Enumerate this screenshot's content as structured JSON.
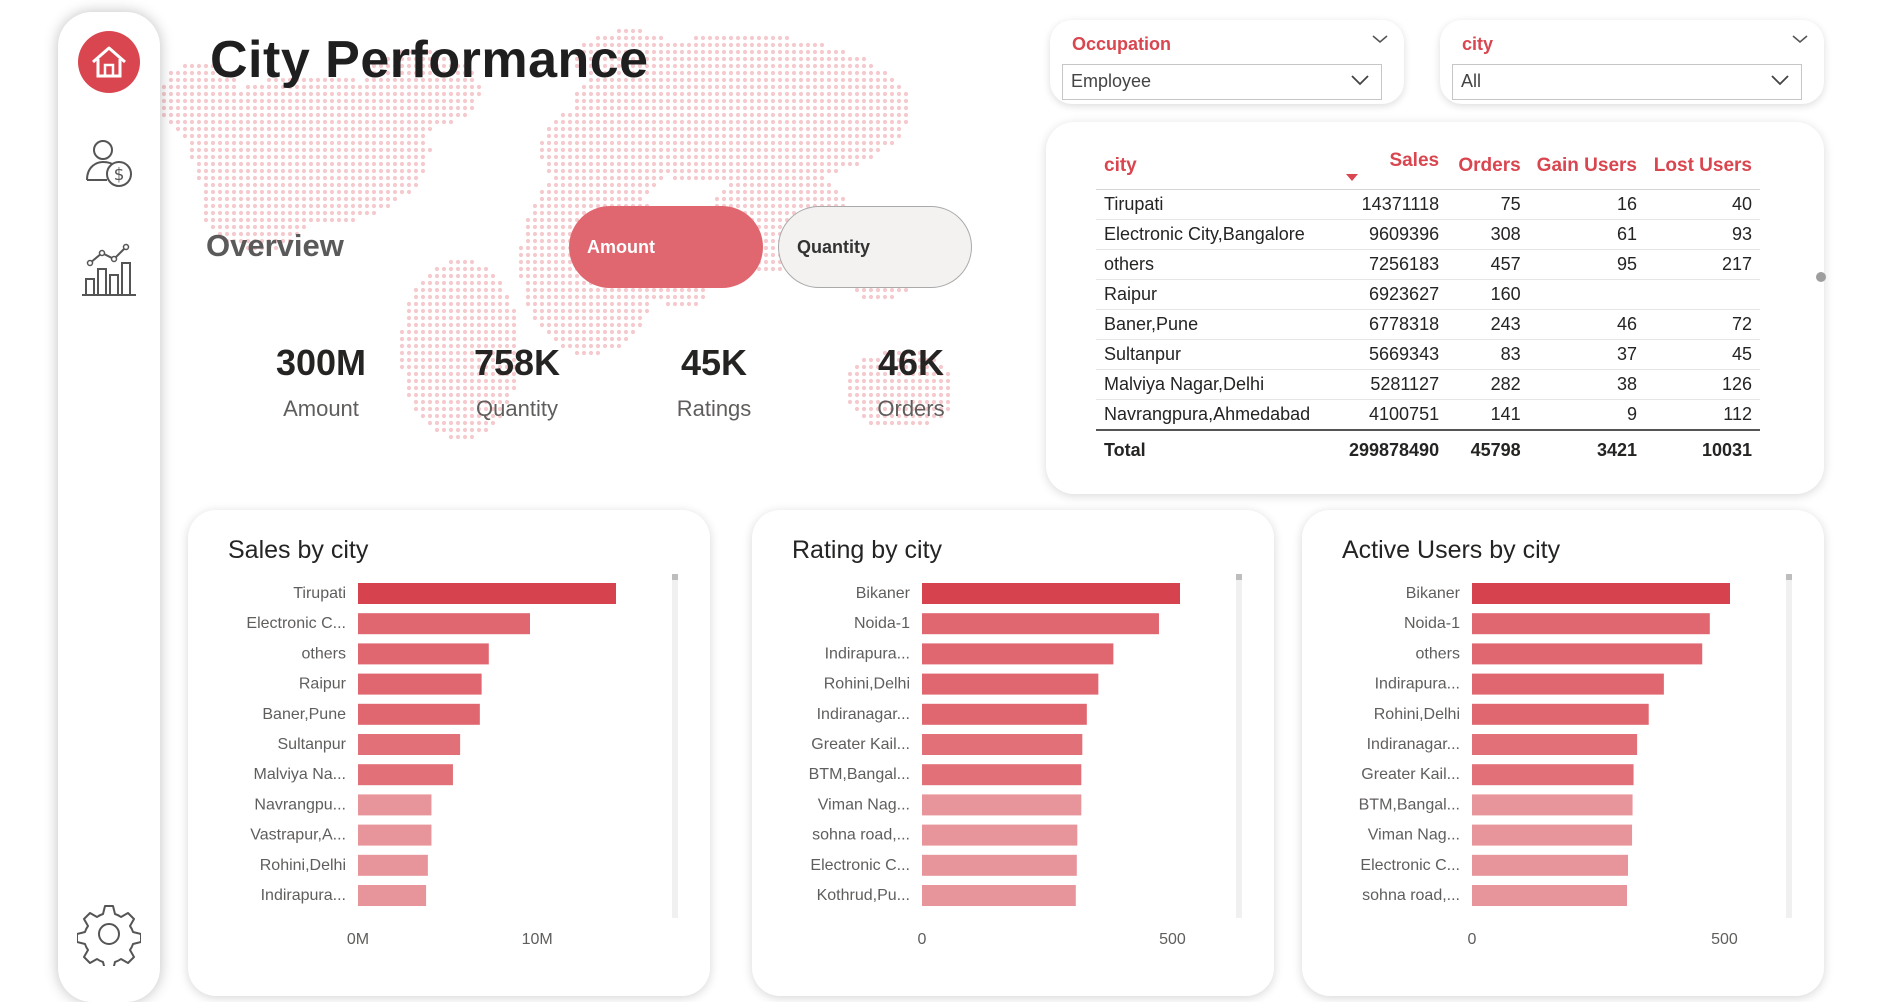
{
  "header": {
    "title": "City Performance",
    "overview_label": "Overview"
  },
  "toggles": {
    "amount": "Amount",
    "quantity": "Quantity"
  },
  "kpis": [
    {
      "value": "300M",
      "label": "Amount"
    },
    {
      "value": "758K",
      "label": "Quantity"
    },
    {
      "value": "45K",
      "label": "Ratings"
    },
    {
      "value": "46K",
      "label": "Orders"
    }
  ],
  "slicers": {
    "occupation": {
      "title": "Occupation",
      "value": "Employee"
    },
    "city": {
      "title": "city",
      "value": "All"
    }
  },
  "table": {
    "headers": [
      "city",
      "Sales",
      "Orders",
      "Gain Users",
      "Lost Users"
    ],
    "rows": [
      [
        "Tirupati",
        "14371118",
        "75",
        "16",
        "40"
      ],
      [
        "Electronic City,Bangalore",
        "9609396",
        "308",
        "61",
        "93"
      ],
      [
        "others",
        "7256183",
        "457",
        "95",
        "217"
      ],
      [
        "Raipur",
        "6923627",
        "160",
        "",
        ""
      ],
      [
        "Baner,Pune",
        "6778318",
        "243",
        "46",
        "72"
      ],
      [
        "Sultanpur",
        "5669343",
        "83",
        "37",
        "45"
      ],
      [
        "Malviya Nagar,Delhi",
        "5281127",
        "282",
        "38",
        "126"
      ],
      [
        "Navrangpura,Ahmedabad",
        "4100751",
        "141",
        "9",
        "112"
      ]
    ],
    "total": [
      "Total",
      "299878490",
      "45798",
      "3421",
      "10031"
    ]
  },
  "colors": {
    "accent": "#d9464f",
    "bar": "#e06670",
    "bar_light": "#e8949b"
  },
  "icons": {
    "home": "home-icon",
    "finance": "user-dollar-icon",
    "analytics": "bar-chart-icon",
    "settings": "gear-icon"
  },
  "chart_data": [
    {
      "type": "bar",
      "title": "Sales by city",
      "categories": [
        "Tirupati",
        "Electronic C...",
        "others",
        "Raipur",
        "Baner,Pune",
        "Sultanpur",
        "Malviya Na...",
        "Navrangpu...",
        "Vastrapur,A...",
        "Rohini,Delhi",
        "Indirapura..."
      ],
      "values": [
        14.4,
        9.6,
        7.3,
        6.9,
        6.8,
        5.7,
        5.3,
        4.1,
        4.1,
        3.9,
        3.8
      ],
      "xlim": [
        0,
        14.4
      ],
      "xticks": [
        {
          "v": 0,
          "label": "0M"
        },
        {
          "v": 10,
          "label": "10M"
        }
      ]
    },
    {
      "type": "bar",
      "title": "Rating by city",
      "categories": [
        "Bikaner",
        "Noida-1",
        "Indirapura...",
        "Rohini,Delhi",
        "Indiranagar...",
        "Greater Kail...",
        "BTM,Bangal...",
        "Viman Nag...",
        "sohna road,...",
        "Electronic C...",
        "Kothrud,Pu..."
      ],
      "values": [
        515,
        473,
        382,
        352,
        329,
        320,
        318,
        318,
        310,
        309,
        307
      ],
      "xlim": [
        0,
        515
      ],
      "xticks": [
        {
          "v": 0,
          "label": "0"
        },
        {
          "v": 500,
          "label": "500"
        }
      ]
    },
    {
      "type": "bar",
      "title": "Active Users by city",
      "categories": [
        "Bikaner",
        "Noida-1",
        "others",
        "Indirapura...",
        "Rohini,Delhi",
        "Indiranagar...",
        "Greater Kail...",
        "BTM,Bangal...",
        "Viman Nag...",
        "Electronic C...",
        "sohna road,..."
      ],
      "values": [
        511,
        471,
        456,
        380,
        350,
        327,
        320,
        318,
        317,
        309,
        307
      ],
      "xlim": [
        0,
        511
      ],
      "xticks": [
        {
          "v": 0,
          "label": "0"
        },
        {
          "v": 500,
          "label": "500"
        }
      ]
    }
  ]
}
